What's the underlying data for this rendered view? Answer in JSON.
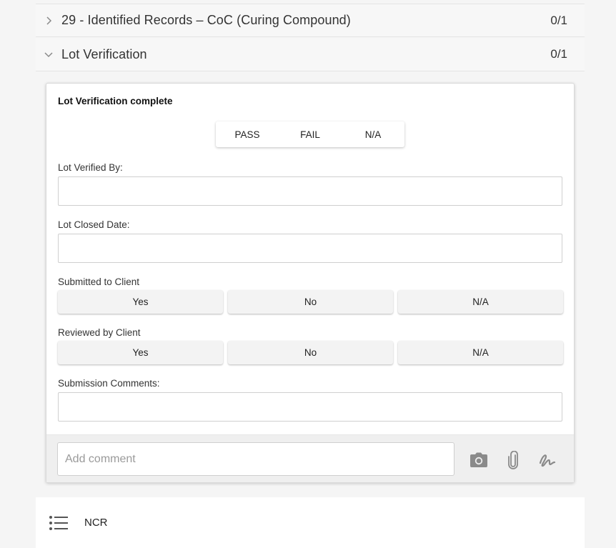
{
  "sections": [
    {
      "title": "29 - Identified Records – CoC (Curing Compound)",
      "count": "0/1",
      "expanded": false
    },
    {
      "title": "Lot Verification",
      "count": "0/1",
      "expanded": true
    }
  ],
  "card": {
    "title": "Lot Verification complete",
    "pass_fail": [
      "PASS",
      "FAIL",
      "N/A"
    ],
    "fields": {
      "lot_verified_by": {
        "label": "Lot Verified By:",
        "value": ""
      },
      "lot_closed_date": {
        "label": "Lot Closed Date:",
        "value": ""
      },
      "submission_comments": {
        "label": "Submission Comments:",
        "value": ""
      }
    },
    "submitted_to_client": {
      "label": "Submitted to Client",
      "options": [
        "Yes",
        "No",
        "N/A"
      ]
    },
    "reviewed_by_client": {
      "label": "Reviewed by Client",
      "options": [
        "Yes",
        "No",
        "N/A"
      ]
    },
    "comment": {
      "placeholder": "Add comment"
    },
    "tools": [
      "camera-icon",
      "paperclip-icon",
      "signature-icon"
    ]
  },
  "ncr": {
    "label": "NCR",
    "icon": "list-icon"
  },
  "colors": {
    "background": "#f5f5f5",
    "card": "#ffffff",
    "button": "#f3f3f3",
    "icon": "#8a8a8a"
  }
}
